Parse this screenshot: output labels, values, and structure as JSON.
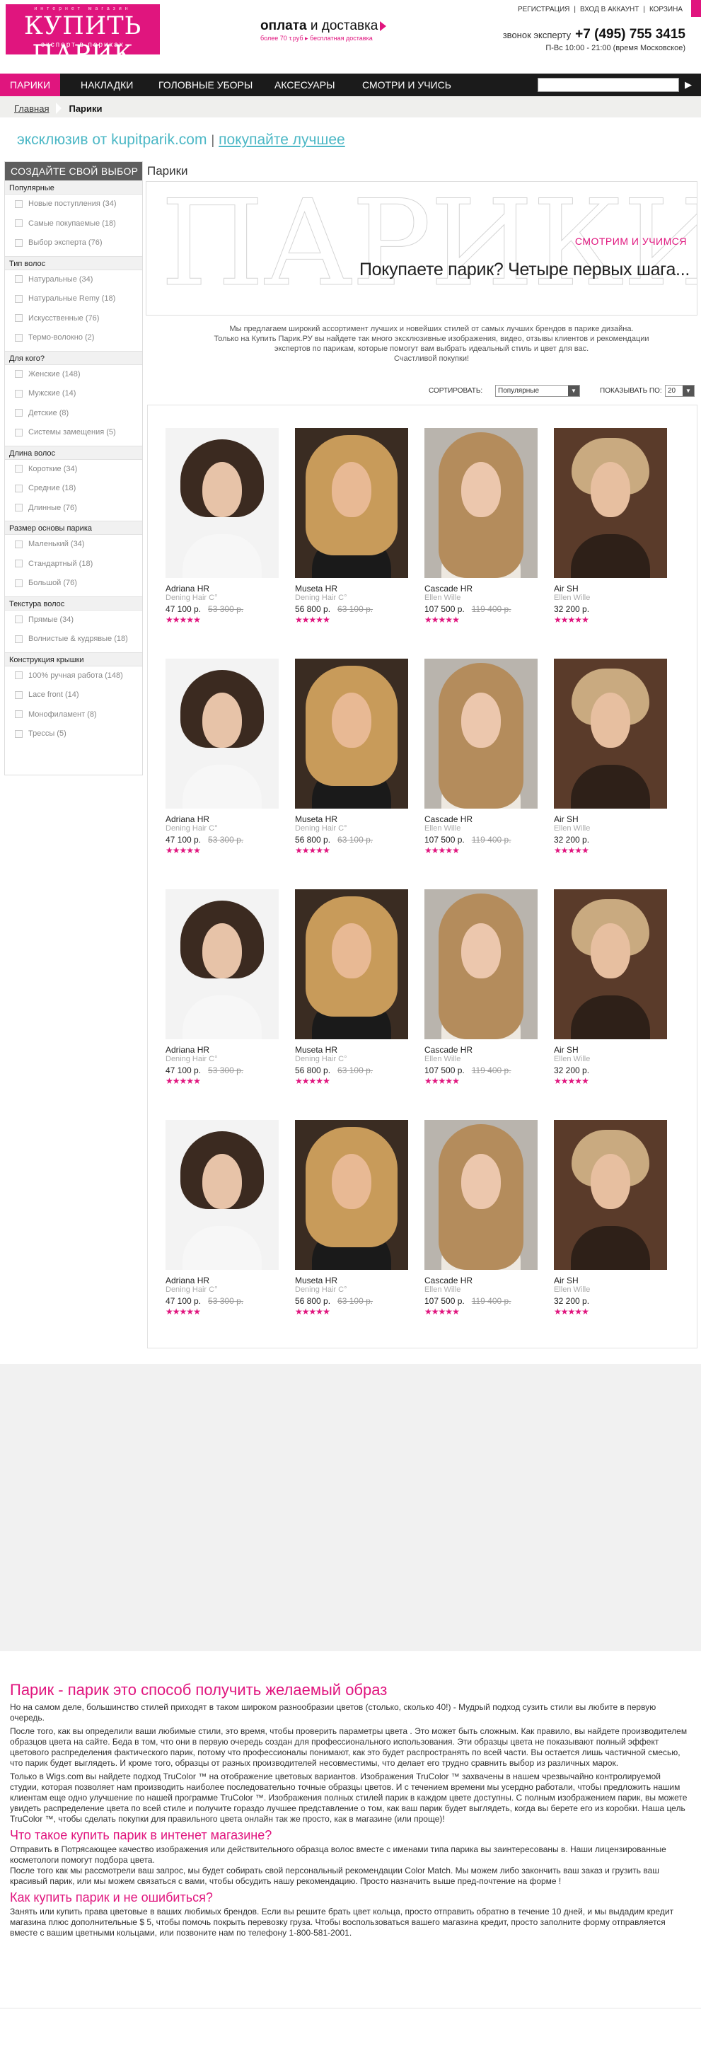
{
  "header": {
    "logo": {
      "top_text": "интернет магазин",
      "name": "КУПИТЬ ПАРИК",
      "subtitle": "эксперт в париках"
    },
    "promo": {
      "title_bold": "оплата",
      "title_rest": " и доставка",
      "subtitle": "более 70 т.руб ▸ бесплатная доставка"
    },
    "links": [
      "РЕГИСТРАЦИЯ",
      "ВХОД В АККАУНТ",
      "КОРЗИНА"
    ],
    "phone_label": "звонок эксперту",
    "phone": "+7 (495) 755 3415",
    "hours": "П-Вс  10:00 - 21:00 (время Московское)",
    "accent": "#e0157e"
  },
  "nav": {
    "items": [
      "ПАРИКИ",
      "НАКЛАДКИ",
      "ГОЛОВНЫЕ УБОРЫ",
      "АКСЕСУАРЫ",
      "СМОТРИ И УЧИСЬ"
    ],
    "search_value": "",
    "search_icon": "play-icon"
  },
  "breadcrumb": {
    "home": "Главная",
    "current": "Парики"
  },
  "tagline": {
    "part1": "эксклюзив от kupitparik.com",
    "sep": "|",
    "part2": "покупайте лучшее"
  },
  "sidebar": {
    "title": "СОЗДАЙТЕ СВОЙ ВЫБОР",
    "groups": [
      {
        "title": "Популярные",
        "options": [
          "Новые поступления (34)",
          "Самые покупаемые  (18)",
          "Выбор эксперта (76)"
        ]
      },
      {
        "title": "Тип волос",
        "options": [
          "Натуральные (34)",
          "Натуральные  Remy  (18)",
          "Искусственные (76)",
          "Термо-волокно (2)"
        ]
      },
      {
        "title": "Для кого?",
        "options": [
          "Женские (148)",
          "Мужские (14)",
          "Детские (8)",
          "Системы замещения (5)"
        ]
      },
      {
        "title": "Длина волос",
        "options": [
          "Короткие (34)",
          "Средние (18)",
          "Длинные (76)"
        ]
      },
      {
        "title": "Размер основы парика",
        "options": [
          "Маленький (34)",
          "Стандартный (18)",
          "Большой (76)"
        ]
      },
      {
        "title": "Текстура волос",
        "options": [
          "Прямые (34)",
          "Волнистые & кудрявые (18)"
        ]
      },
      {
        "title": "Конструкция крышки",
        "options": [
          "100% ручная работа (148)",
          "Lace front (14)",
          "Монофиламент (8)",
          "Трессы (5)"
        ]
      }
    ]
  },
  "main": {
    "title": "Парики",
    "banner": {
      "big_word": "ПАРИКИ",
      "watch": "СМОТРИМ И УЧИМСЯ",
      "headline": "Покупаете парик? Четыре первых шага..."
    },
    "intro": [
      "Мы предлагаем широкий ассортимент лучших и новейших стилей от самых лучших брендов в парике дизайна.",
      "Только на Купить Парик.РУ вы найдете так много эксклюзивные изображения, видео, отзывы клиентов и рекомендации",
      "экспертов по парикам, которые помогут вам выбрать идеальный стиль и цвет для вас.",
      "Счастливой покупки!"
    ],
    "sort_label": "СОРТИРОВАТЬ:",
    "sort_value": "Популярные",
    "show_label": "ПОКАЗЫВАТЬ ПО:",
    "show_value": "20"
  },
  "products": [
    {
      "name": "Adriana HR",
      "brand": "Dening Hair C°",
      "price": "47 100 р.",
      "old_price": "53 300 р.",
      "rating": 5,
      "style": "dark-bob"
    },
    {
      "name": "Museta HR",
      "brand": "Dening Hair C°",
      "price": "56 800 р.",
      "old_price": "63 100 р.",
      "rating": 5,
      "style": "blonde-mid"
    },
    {
      "name": "Cascade HR",
      "brand": "Ellen Wille",
      "price": "107 500 р.",
      "old_price": "119 400 р.",
      "rating": 5,
      "style": "long-wavy"
    },
    {
      "name": "Air SH",
      "brand": "Ellen Wille",
      "price": "32 200 р.",
      "old_price": "",
      "rating": 5,
      "style": "short-pixie"
    }
  ],
  "seo": {
    "h1": "Парик - парик это способ получить желаемый образ",
    "p1": "Но на самом деле, большинство стилей приходят в таком широком разнообразии цветов (столько, сколько 40!) - Мудрый подход сузить стили вы любите в первую очередь.",
    "p2": "После того, как вы определили ваши любимые стили, это время, чтобы проверить параметры цвета . Это может быть сложным. Как правило, вы найдете производителем образцов цвета на сайте. Беда в том, что они в первую очередь создан для профессионального использования. Эти образцы цвета не показывают полный эффект цветового распределения фактического парик, потому что профессионалы понимают, как это будет распространять по всей части. Вы остается лишь частичной смесью, что парик будет выглядеть. И кроме того, образцы от разных производителей несовместимы, что делает его трудно сравнить выбор из различных марок.",
    "p3": "Только в Wigs.com вы найдете подход TruColor ™ на отображение цветовых вариантов. Изображения TruColor ™ захвачены в нашем чрезвычайно контролируемой студии, которая позволяет нам производить наиболее последовательно точные образцы цветов. И с течением времени мы усердно работали, чтобы предложить нашим клиентам еще одно улучшение по нашей программе TruColor ™. Изображения полных стилей парик в каждом цвете доступны. С полным изображением парик, вы можете увидеть распределение цвета по всей стиле и получите гораздо лучшее представление о том, как ваш парик будет выглядеть, когда вы берете его из коробки. Наша цель TruColor ™, чтобы сделать покупки для правильного цвета онлайн так же просто, как в магазине (или проще)!",
    "h2": "Что такое купить парик в интенет магазине?",
    "p4": "Отправить в Потрясающее качество изображения или действительного образца волос вместе с именами типа парика вы заинтересованы в. Наши лицензированные косметологи помогут подбора цвета.",
    "p5": "После того как мы рассмотрели ваш запрос, мы будет собирать свой персональный рекомендации Color Match. Мы можем либо закончить ваш заказ и грузить ваш красивый парик, или мы можем связаться с вами, чтобы обсудить нашу рекомендацию. Просто назначить выше пред-почтение на форме !",
    "h3": "Как купить парик и не ошибиться?",
    "p6": "Занять или купить права цветовые в ваших любимых брендов. Если вы решите брать цвет кольца, просто отправить обратно в течение 10 дней, и мы выдадим кредит магазина плюс дополнительные $ 5, чтобы помочь покрыть перевозку груза. Чтобы воспользоваться вашего магазина кредит, просто заполните форму отправляется вместе с вашим цветными кольцами, или позвоните нам по телефону 1-800-581-2001."
  }
}
